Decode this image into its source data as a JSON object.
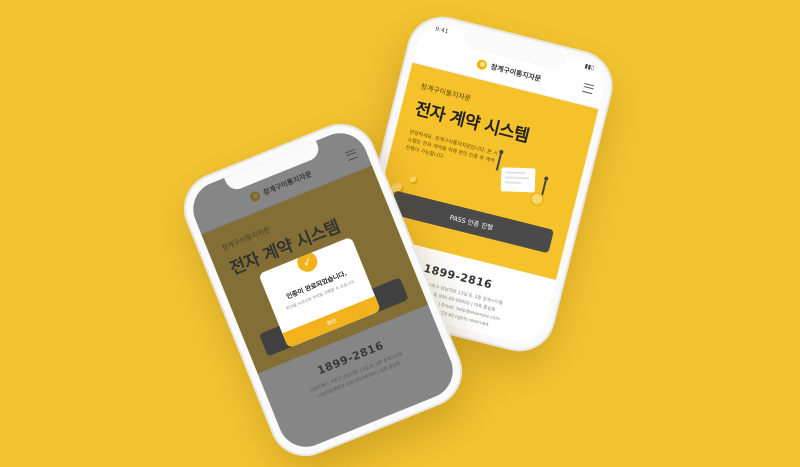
{
  "app": {
    "logo_text": "창계구이통지자문",
    "status_time": "9:41"
  },
  "hero": {
    "subtitle": "창계구이통지자문",
    "title": "전자 계약 시스템",
    "description": "안녕하세요. 창계구이통지자문입니다. 본 시스템은 전자 계약을 위해 본인 인증 후 계약 진행이 가능합니다."
  },
  "pass_button": {
    "label": "PASS 인증 진행"
  },
  "footer": {
    "phone": "1899-2816",
    "info_lines": [
      "서울특별시 서초구 강남대로 13길 8, 2층 창계구이통",
      "사업자등록번호 000-00-00000 | 대표 홍길동",
      "개인정보보호책임자 | Email. help@example.com",
      "Copyright © 2023 All rights reserved."
    ]
  },
  "modal": {
    "title": "인증이 완료되었습니다.",
    "description": "확인을 누르시면 계약을 진행할 수 있습니다.",
    "confirm_label": "확인"
  },
  "colors": {
    "background": "#f3c431",
    "accent": "#f3b21c",
    "button_dark": "#4a4a4a"
  }
}
